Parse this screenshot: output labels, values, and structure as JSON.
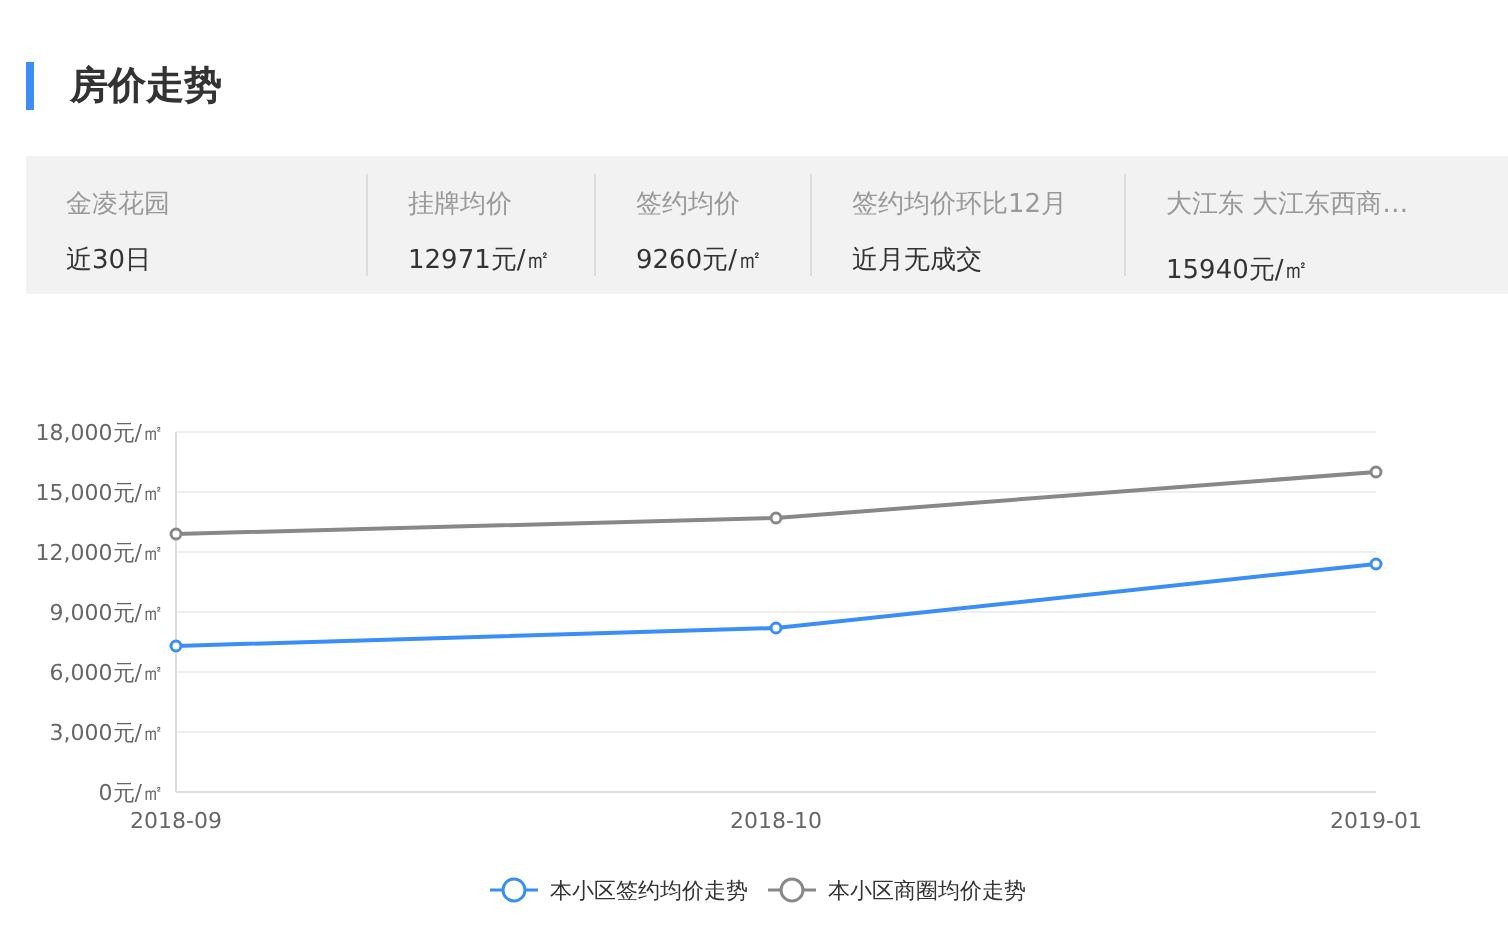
{
  "title": "房价走势",
  "summary": [
    {
      "label": "金凌花园",
      "value": "近30日"
    },
    {
      "label": "挂牌均价",
      "value": "12971元/㎡"
    },
    {
      "label": "签约均价",
      "value": "9260元/㎡"
    },
    {
      "label": "签约均价环比12月",
      "value": "近月无成交"
    },
    {
      "label": "大江东 大江东西商…",
      "value": "15940元/㎡"
    }
  ],
  "chart": {
    "chart_data": {
      "type": "line",
      "grid": true,
      "legend": "bottom",
      "categories": [
        "2018-09",
        "2018-10",
        "2019-01"
      ],
      "series": [
        {
          "name": "本小区签约均价走势",
          "color": "#3a8ef6",
          "marker": "circle",
          "values": [
            7300,
            8200,
            11400
          ]
        },
        {
          "name": "本小区商圈均价走势",
          "color": "#888888",
          "marker": "circle",
          "values": [
            12900,
            13700,
            16000
          ]
        }
      ],
      "ylim": [
        0,
        18000
      ],
      "yticks": [
        {
          "value": 0,
          "label": "0元/㎡"
        },
        {
          "value": 3000,
          "label": "3,000元/㎡"
        },
        {
          "value": 6000,
          "label": "6,000元/㎡"
        },
        {
          "value": 9000,
          "label": "9,000元/㎡"
        },
        {
          "value": 12000,
          "label": "12,000元/㎡"
        },
        {
          "value": 15000,
          "label": "15,000元/㎡"
        },
        {
          "value": 18000,
          "label": "18,000元/㎡"
        }
      ]
    }
  }
}
